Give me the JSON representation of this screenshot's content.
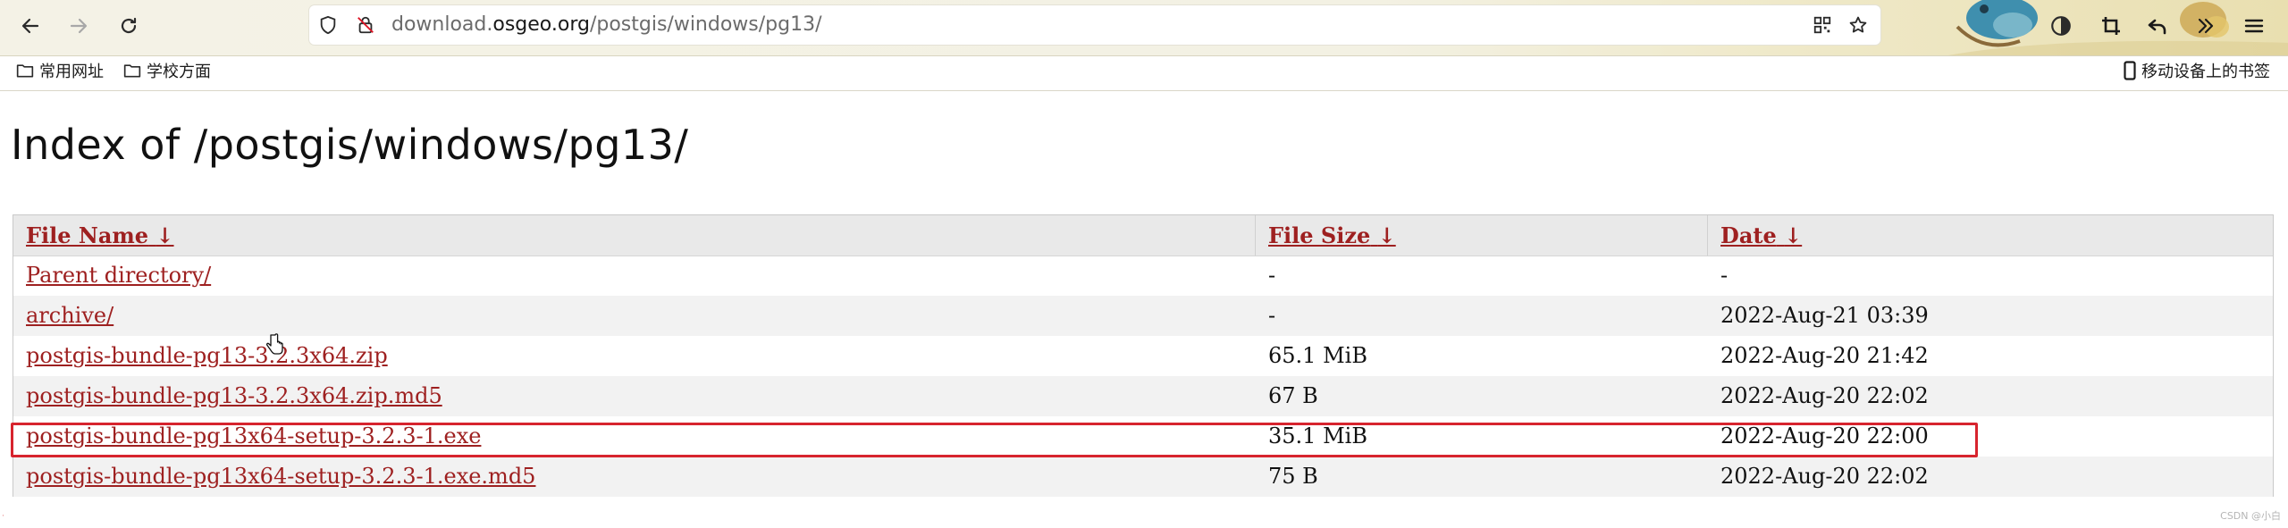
{
  "browser": {
    "url_prefix": "download.",
    "url_domain": "osgeo.org",
    "url_path": "/postgis/windows/pg13/",
    "bookmarks": [
      {
        "label": "常用网址"
      },
      {
        "label": "学校方面"
      }
    ],
    "mobile_bookmarks_label": "移动设备上的书签",
    "icons": {
      "back": "back-arrow-icon",
      "forward": "forward-arrow-icon",
      "reload": "reload-icon",
      "shield": "tracking-protection-shield-icon",
      "lock": "insecure-lock-icon",
      "qr": "qr-code-icon",
      "star": "bookmark-star-icon",
      "extensions": [
        "timer-icon",
        "crop-icon",
        "undo-icon",
        "overflow-chevrons-icon",
        "hamburger-menu-icon"
      ]
    }
  },
  "page": {
    "title": "Index of /postgis/windows/pg13/",
    "columns": {
      "name": "File Name",
      "size": "File Size",
      "date": "Date",
      "sort_marker": "↓"
    },
    "rows": [
      {
        "name": "Parent directory/",
        "size": "-",
        "date": "-"
      },
      {
        "name": "archive/",
        "size": "-",
        "date": "2022-Aug-21 03:39"
      },
      {
        "name": "postgis-bundle-pg13-3.2.3x64.zip",
        "size": "65.1 MiB",
        "date": "2022-Aug-20 21:42"
      },
      {
        "name": "postgis-bundle-pg13-3.2.3x64.zip.md5",
        "size": "67 B",
        "date": "2022-Aug-20 22:02"
      },
      {
        "name": "postgis-bundle-pg13x64-setup-3.2.3-1.exe",
        "size": "35.1 MiB",
        "date": "2022-Aug-20 22:00"
      },
      {
        "name": "postgis-bundle-pg13x64-setup-3.2.3-1.exe.md5",
        "size": "75 B",
        "date": "2022-Aug-20 22:02"
      }
    ],
    "highlighted_row_index": 4,
    "highlight_color": "#d7242e",
    "link_color": "#9e2020"
  },
  "watermark": "CSDN @小白"
}
